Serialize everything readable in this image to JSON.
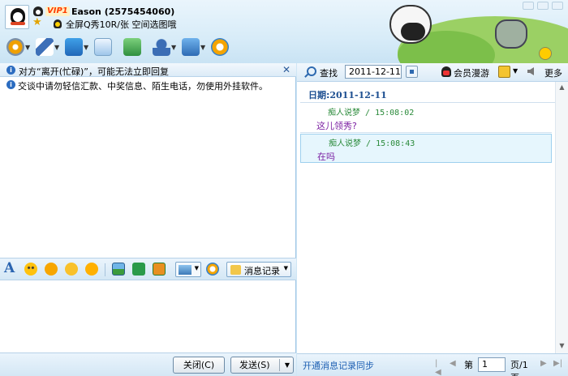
{
  "header": {
    "vip_label": "VIP1",
    "user_name": "Eason  (2575454060)",
    "status_message": "全屏Q秀10R/张 空间选图哦"
  },
  "left_panel": {
    "notice_text": "对方“离开(忙碌)”，可能无法立即回复",
    "warning_text": "交谈中请勿轻信汇款、中奖信息、陌生电话，勿使用外挂软件。",
    "history_button": "消息记录",
    "close_button": "关闭(C)",
    "send_button": "发送(S)"
  },
  "right_panel": {
    "find_label": "查找",
    "date_value": "2011-12-11",
    "member_label": "会员漫游",
    "more_label": "更多",
    "date_header_label": "日期:",
    "date_header_value": "2011-12-11",
    "messages": [
      {
        "sender": "痴人说梦",
        "time": "/ 15:08:02",
        "text": "这儿领秀?"
      },
      {
        "sender": "痴人说梦",
        "time": "/ 15:08:43",
        "text": "在吗"
      }
    ],
    "sync_link": "开通消息记录同步",
    "pager": {
      "first": "|◀",
      "prev": "◀",
      "page_prefix": "第",
      "page_value": "1",
      "page_total": "页/1页",
      "next": "▶",
      "last": "▶|"
    }
  },
  "icons": {
    "toolbar": [
      "video-icon",
      "mic-icon",
      "folder-icon",
      "mail-icon",
      "doc-icon",
      "people-icon",
      "settings-icon",
      "safe-icon"
    ],
    "input_toolbar": [
      "font-icon",
      "smile-icon",
      "shake-icon",
      "gift-icon",
      "cute-icon",
      "image-icon",
      "music-icon",
      "screenshot-icon",
      "screen-share-icon",
      "safe-icon"
    ]
  },
  "colors": {
    "accent": "#2b6cc0",
    "message_sender": "#2a8a3a",
    "message_text": "#7b1fa2",
    "link": "#1d5fb3"
  }
}
